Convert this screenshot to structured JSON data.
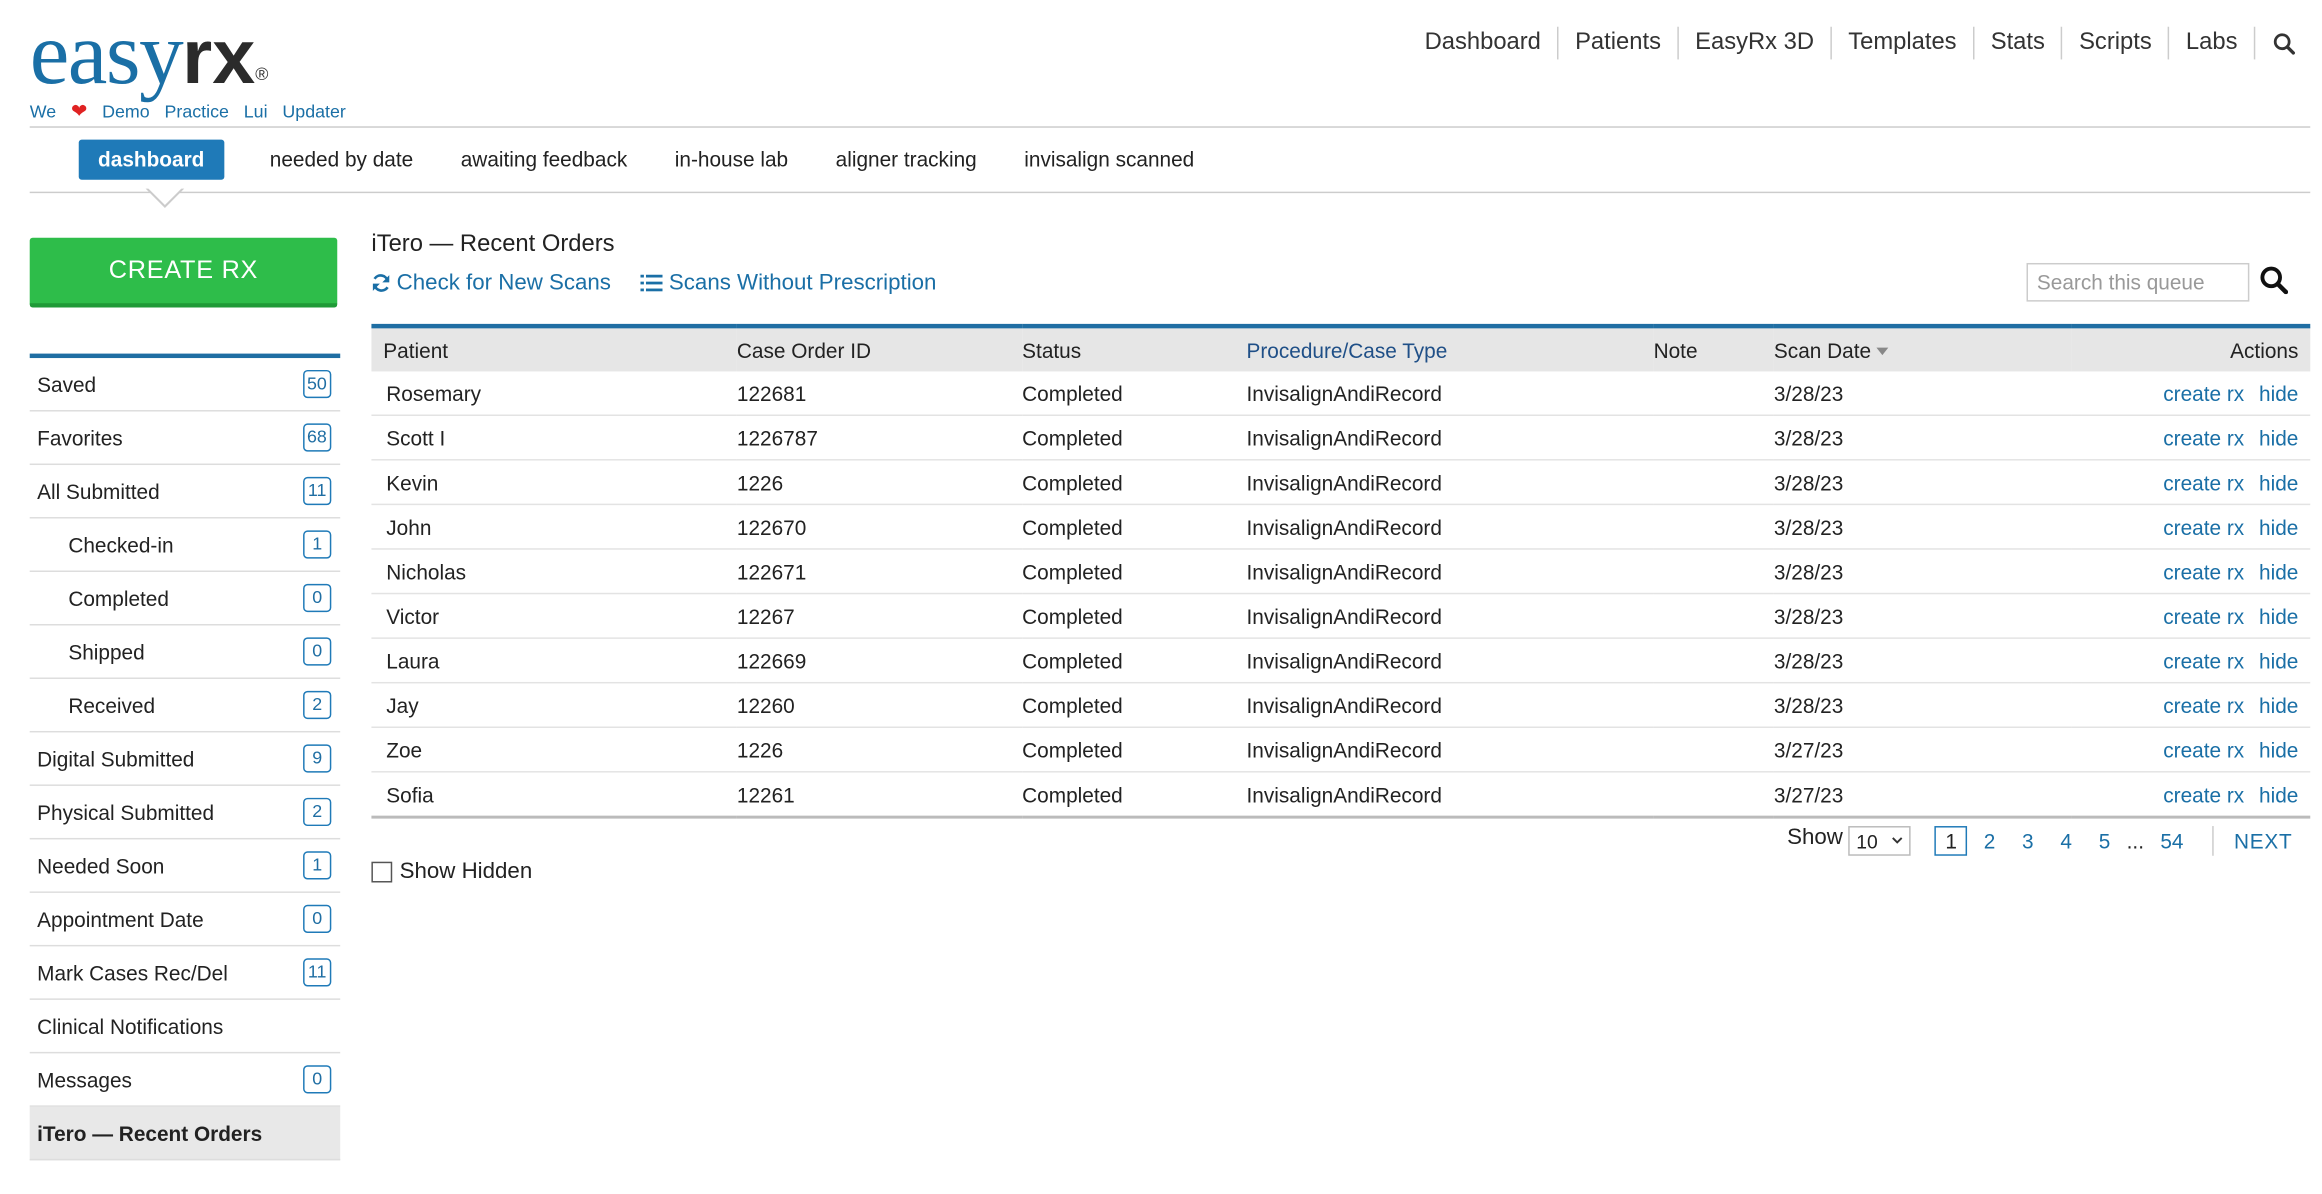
{
  "logo": {
    "easy": "easy",
    "rx": "rx",
    "reg": "®"
  },
  "sublinks": {
    "we": "We",
    "heart": "❤",
    "links": [
      "Demo",
      "Practice",
      "Lui",
      "Updater"
    ]
  },
  "topnav": [
    "Dashboard",
    "Patients",
    "EasyRx 3D",
    "Templates",
    "Stats",
    "Scripts",
    "Labs"
  ],
  "subtabs": [
    "dashboard",
    "needed by date",
    "awaiting feedback",
    "in-house lab",
    "aligner tracking",
    "invisalign scanned"
  ],
  "create_rx": "CREATE RX",
  "sidebar": [
    {
      "label": "Saved",
      "count": "50"
    },
    {
      "label": "Favorites",
      "count": "68"
    },
    {
      "label": "All Submitted",
      "count": "11"
    },
    {
      "label": "Checked-in",
      "count": "1"
    },
    {
      "label": "Completed",
      "count": "0"
    },
    {
      "label": "Shipped",
      "count": "0"
    },
    {
      "label": "Received",
      "count": "2"
    },
    {
      "label": "Digital Submitted",
      "count": "9"
    },
    {
      "label": "Physical Submitted",
      "count": "2"
    },
    {
      "label": "Needed Soon",
      "count": "1"
    },
    {
      "label": "Appointment Date",
      "count": "0"
    },
    {
      "label": "Mark Cases Rec/Del",
      "count": "11"
    },
    {
      "label": "Clinical Notifications"
    },
    {
      "label": "Messages",
      "count": "0"
    },
    {
      "label": "iTero — Recent Orders"
    }
  ],
  "main": {
    "title": "iTero — Recent Orders",
    "check_scans": "Check for New Scans",
    "scans_without_rx": "Scans Without Prescription",
    "search_placeholder": "Search this queue"
  },
  "table": {
    "headers": {
      "patient": "Patient",
      "case": "Case Order ID",
      "status": "Status",
      "proc": "Procedure/Case Type",
      "note": "Note",
      "date": "Scan Date",
      "actions": "Actions"
    },
    "action_create": "create rx",
    "action_hide": "hide",
    "rows": [
      {
        "patient": "Rosemary",
        "case": "122681",
        "status": "Completed",
        "proc": "InvisalignAndiRecord",
        "note": "",
        "date": "3/28/23"
      },
      {
        "patient": "Scott I",
        "case": "1226787",
        "status": "Completed",
        "proc": "InvisalignAndiRecord",
        "note": "",
        "date": "3/28/23"
      },
      {
        "patient": "Kevin",
        "case": "1226",
        "status": "Completed",
        "proc": "InvisalignAndiRecord",
        "note": "",
        "date": "3/28/23"
      },
      {
        "patient": "John",
        "case": "122670",
        "status": "Completed",
        "proc": "InvisalignAndiRecord",
        "note": "",
        "date": "3/28/23"
      },
      {
        "patient": "Nicholas",
        "case": "122671",
        "status": "Completed",
        "proc": "InvisalignAndiRecord",
        "note": "",
        "date": "3/28/23"
      },
      {
        "patient": "Victor",
        "case": "12267",
        "status": "Completed",
        "proc": "InvisalignAndiRecord",
        "note": "",
        "date": "3/28/23"
      },
      {
        "patient": "Laura",
        "case": "122669",
        "status": "Completed",
        "proc": "InvisalignAndiRecord",
        "note": "",
        "date": "3/28/23"
      },
      {
        "patient": "Jay",
        "case": "12260",
        "status": "Completed",
        "proc": "InvisalignAndiRecord",
        "note": "",
        "date": "3/28/23"
      },
      {
        "patient": "Zoe",
        "case": "1226",
        "status": "Completed",
        "proc": "InvisalignAndiRecord",
        "note": "",
        "date": "3/27/23"
      },
      {
        "patient": "Sofia",
        "case": "12261",
        "status": "Completed",
        "proc": "InvisalignAndiRecord",
        "note": "",
        "date": "3/27/23"
      }
    ]
  },
  "show_hidden": "Show Hidden",
  "pager": {
    "show_label": "Show",
    "page_size": "10",
    "pages": [
      "1",
      "2",
      "3",
      "4",
      "5"
    ],
    "dots": "...",
    "last": "54",
    "next": "NEXT"
  },
  "colors": {
    "accent": "#1f7ab8",
    "create_green": "#2ebd4a",
    "link": "#1a6fa6",
    "heart": "#e02222"
  }
}
